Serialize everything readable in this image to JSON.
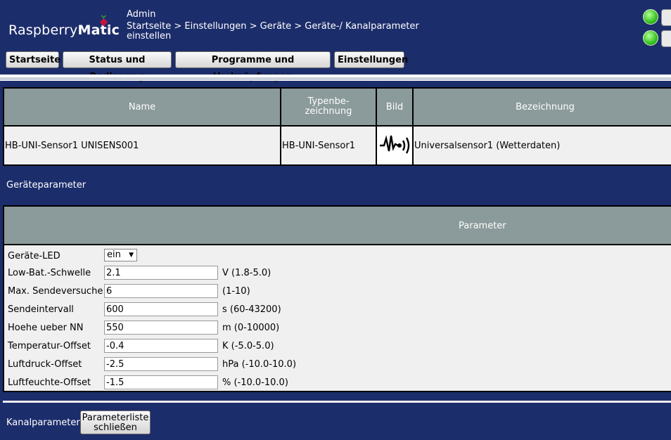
{
  "header": {
    "logo_light": "Raspberry",
    "logo_bold": "Matic",
    "user": "Admin",
    "breadcrumb": "Startseite > Einstellungen > Geräte > Geräte-/ Kanalparameter einstellen"
  },
  "nav": {
    "items": [
      "Startseite",
      "Status und Bedienung",
      "Programme und Verknüpfungen",
      "Einstellungen"
    ]
  },
  "device_table": {
    "headers": {
      "name": "Name",
      "type": "Typenbe-\nzeichnung",
      "image": "Bild",
      "description": "Bezeichnung"
    },
    "row": {
      "name": "HB-UNI-Sensor1 UNISENS001",
      "type": "HB-UNI-Sensor1",
      "description": "Universalsensor1 (Wetterdaten)"
    }
  },
  "device_params": {
    "section_label": "Geräteparameter",
    "header": "Parameter",
    "led": {
      "label": "Geräte-LED",
      "value": "ein"
    },
    "fields": [
      {
        "label": "Low-Bat.-Schwelle",
        "value": "2.1",
        "unit": "V (1.8-5.0)"
      },
      {
        "label": "Max. Sendeversuche",
        "value": "6",
        "unit": "(1-10)"
      },
      {
        "label": "Sendeintervall",
        "value": "600",
        "unit": "s (60-43200)"
      },
      {
        "label": "Hoehe ueber NN",
        "value": "550",
        "unit": "m (0-10000)"
      },
      {
        "label": "Temperatur-Offset",
        "value": "-0.4",
        "unit": "K (-5.0-5.0)"
      },
      {
        "label": "Luftdruck-Offset",
        "value": "-2.5",
        "unit": "hPa (-10.0-10.0)"
      },
      {
        "label": "Luftfeuchte-Offset",
        "value": "-1.5",
        "unit": "% (-10.0-10.0)"
      }
    ]
  },
  "channel_params": {
    "section_label": "Kanalparameter",
    "close_button": "Parameterliste schließen"
  },
  "colors": {
    "background": "#1c2d6b",
    "table_header": "#8b9a9a",
    "led_green": "#35c21e"
  }
}
